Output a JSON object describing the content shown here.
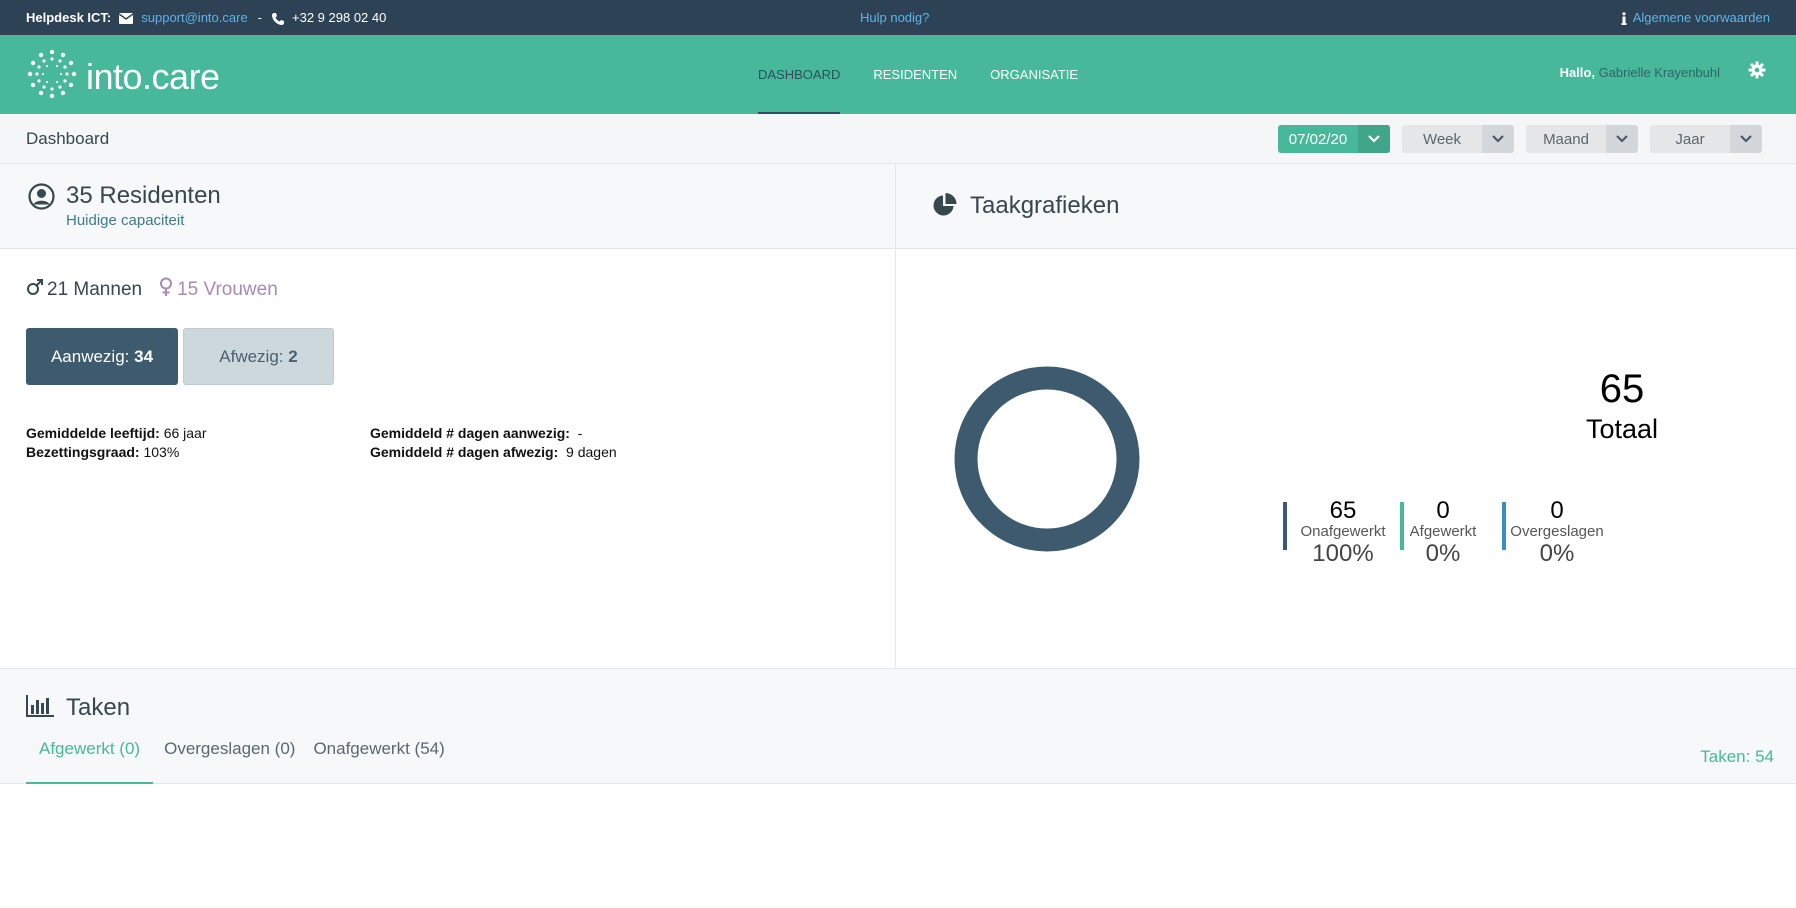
{
  "topbar": {
    "helpdesk_label": "Helpdesk ICT:",
    "email": "support@into.care",
    "separator": "-",
    "phone": "+32 9 298 02 40",
    "help_link": "Hulp nodig?",
    "terms_link": "Algemene voorwaarden"
  },
  "header": {
    "brand": "into.care",
    "nav": [
      "DASHBOARD",
      "RESIDENTEN",
      "ORGANISATIE"
    ],
    "greeting": "Hallo,",
    "user_name": "Gabrielle Krayenbuhl"
  },
  "subheader": {
    "title": "Dashboard",
    "date": "07/02/20",
    "week": "Week",
    "month": "Maand",
    "year": "Jaar"
  },
  "residents": {
    "count_title": "35 Residenten",
    "subtitle": "Huidige capaciteit",
    "men": "21 Mannen",
    "women": "15 Vrouwen",
    "present_label": "Aanwezig:",
    "present_value": "34",
    "absent_label": "Afwezig:",
    "absent_value": "2",
    "avg_age_label": "Gemiddelde leeftijd:",
    "avg_age_value": "66 jaar",
    "occupancy_label": "Bezettingsgraad:",
    "occupancy_value": "103%",
    "avg_days_present_label": "Gemiddeld # dagen aanwezig:",
    "avg_days_present_value": "-",
    "avg_days_absent_label": "Gemiddeld # dagen afwezig:",
    "avg_days_absent_value": "9 dagen"
  },
  "task_charts": {
    "title": "Taakgrafieken",
    "total_value": "65",
    "total_label": "Totaal",
    "breakdown": [
      {
        "value": "65",
        "label": "Onafgewerkt",
        "pct": "100%",
        "color": "#3d5a6e",
        "fraction": 1.0
      },
      {
        "value": "0",
        "label": "Afgewerkt",
        "pct": "0%",
        "color": "#48b89a",
        "fraction": 0.0
      },
      {
        "value": "0",
        "label": "Overgeslagen",
        "pct": "0%",
        "color": "#3a8fc2",
        "fraction": 0.0
      }
    ]
  },
  "tasks": {
    "title": "Taken",
    "tabs": [
      "Afgewerkt (0)",
      "Overgeslagen (0)",
      "Onafgewerkt (54)"
    ],
    "count": "Taken: 54"
  },
  "colors": {
    "topbar": "#2e4256",
    "brand_green": "#48b89a",
    "dark_slate": "#3d5a6e"
  }
}
